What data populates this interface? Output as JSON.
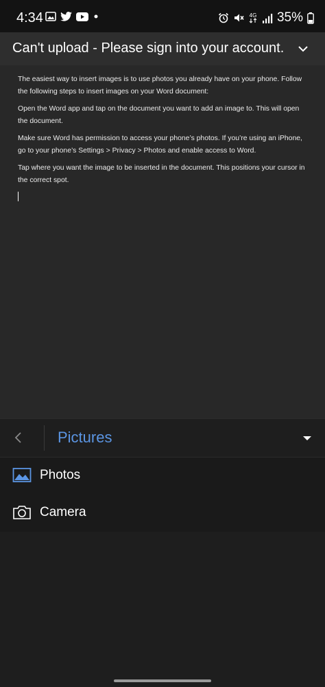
{
  "status_bar": {
    "time": "4:34",
    "left_icons": [
      "gallery-icon",
      "twitter-icon",
      "youtube-icon",
      "dot-icon"
    ],
    "right_icons": [
      "alarm-icon",
      "mute-icon",
      "network-4g-icon",
      "signal-icon",
      "battery-icon"
    ],
    "network_label": "4G",
    "battery_percent": "35%"
  },
  "banner": {
    "text": "Can't upload - Please sign into your account."
  },
  "document": {
    "paragraphs": [
      "The easiest way to insert images is to use photos you already have on your phone. Follow the following steps to insert images on your Word document:",
      "Open the Word app and tap on the document you want to add an image to. This will open the document.",
      "Make sure Word has permission to access your phone’s photos. If you’re using an iPhone, go to your phone’s Settings > Privacy > Photos and enable access to Word.",
      "Tap where you want the image to be inserted in the document. This positions your cursor in the correct spot."
    ]
  },
  "picker": {
    "title": "Pictures",
    "items": [
      {
        "label": "Photos",
        "icon": "photos-icon"
      },
      {
        "label": "Camera",
        "icon": "camera-icon"
      }
    ]
  },
  "colors": {
    "accent": "#5b95e3",
    "banner_bg": "#2e2e2e",
    "doc_bg": "#282828",
    "picker_bg": "#1e1e1e"
  }
}
